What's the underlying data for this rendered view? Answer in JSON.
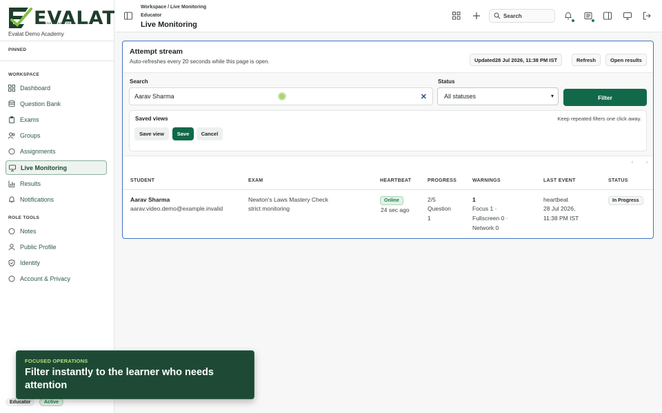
{
  "app": {
    "logo_text": "EVALAT",
    "logo_tagline": "ASSESS SMART GROW FUTURE",
    "org_name": "Evalat Demo Academy"
  },
  "sidebar": {
    "pinned_label": "PINNED",
    "workspace_label": "WORKSPACE",
    "workspace_items": [
      {
        "label": "Dashboard",
        "icon": "dashboard-icon"
      },
      {
        "label": "Question Bank",
        "icon": "database-icon"
      },
      {
        "label": "Exams",
        "icon": "clipboard-icon"
      },
      {
        "label": "Groups",
        "icon": "users-icon"
      },
      {
        "label": "Assignments",
        "icon": "circle-icon"
      },
      {
        "label": "Live Monitoring",
        "icon": "monitor-icon",
        "active": true
      },
      {
        "label": "Results",
        "icon": "bar-chart-icon"
      },
      {
        "label": "Notifications",
        "icon": "bell-icon"
      }
    ],
    "role_tools_label": "ROLE TOOLS",
    "role_items": [
      {
        "label": "Notes",
        "icon": "circle-icon"
      },
      {
        "label": "Public Profile",
        "icon": "user-icon"
      },
      {
        "label": "Identity",
        "icon": "shield-check-icon"
      },
      {
        "label": "Account & Privacy",
        "icon": "circle-icon"
      }
    ],
    "role": "Educator",
    "role_status": "Active"
  },
  "header": {
    "breadcrumb": "Workspace / Live Monitoring",
    "role": "Educator",
    "title": "Live Monitoring",
    "search_placeholder": "Search"
  },
  "stream": {
    "title": "Attempt stream",
    "subtitle": "Auto-refreshes every 20 seconds while this page is open.",
    "updated": "Updated28 Jul 2026, 11:38 PM IST",
    "refresh_label": "Refresh",
    "open_results_label": "Open results",
    "search_label": "Search",
    "search_value": "Aarav Sharma",
    "status_label": "Status",
    "status_value": "All statuses",
    "filter_label": "Filter",
    "saved_views_label": "Saved views",
    "saved_views_hint": "Keep repeated filters one click away.",
    "save_view_label": "Save view",
    "save_label": "Save",
    "cancel_label": "Cancel",
    "columns": [
      "STUDENT",
      "EXAM",
      "HEARTBEAT",
      "PROGRESS",
      "WARNINGS",
      "LAST EVENT",
      "STATUS"
    ],
    "rows": [
      {
        "student_name": "Aarav Sharma",
        "student_email": "aarav.video.demo@example.invalid",
        "exam_name": "Newton's Laws Mastery Check",
        "exam_mode": "strict monitoring",
        "heartbeat_status": "Online",
        "heartbeat_time": "24 sec ago",
        "progress_fraction": "2/5",
        "progress_question_label": "Question",
        "progress_question_number": "1",
        "warnings_total": "1",
        "warnings_line1": "Focus 1 ·",
        "warnings_line2": "Fullscreen 0 ·",
        "warnings_line3": "Network 0",
        "last_event_type": "heartbeat",
        "last_event_date": "28 Jul 2026,",
        "last_event_time": "11:38 PM IST",
        "status": "In Progress"
      }
    ]
  },
  "toast": {
    "label": "FOCUSED OPERATIONS",
    "text": "Filter instantly to the learner who needs attention"
  },
  "colors": {
    "brand": "#11694a",
    "accent_border": "#3f74c4",
    "toast_bg": "#1e4a35",
    "online_bg": "#e1f3e6"
  }
}
